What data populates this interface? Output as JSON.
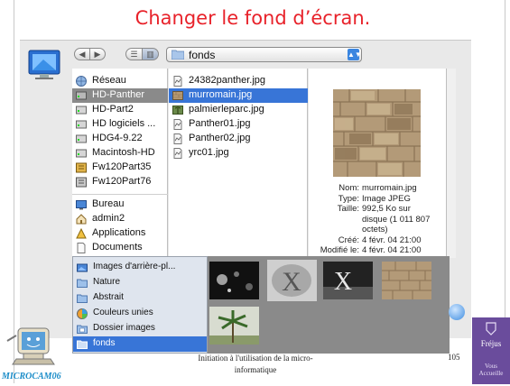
{
  "slide": {
    "title": "Changer le fond d’écran.",
    "footer": "Initiation à l'utilisation de la micro-informatique",
    "page_number": "105",
    "mascot_label": "MICROCAM06",
    "logo_text": "Fréjus",
    "logo_subtext": "Vous Accueille"
  },
  "toolbar": {
    "back_label": "◀",
    "forward_label": "▶",
    "list_view_label": "☰",
    "column_view_label": "▥",
    "path_title": "fonds"
  },
  "sidebar": [
    {
      "label": "Réseau",
      "icon": "globe-icon"
    },
    {
      "label": "HD-Panther",
      "icon": "hard-drive-icon",
      "selected": true
    },
    {
      "label": "HD-Part2",
      "icon": "hard-drive-icon"
    },
    {
      "label": "HD logiciels ...",
      "icon": "hard-drive-icon"
    },
    {
      "label": "HDG4-9.22",
      "icon": "hard-drive-icon"
    },
    {
      "label": "Macintosh-HD",
      "icon": "hard-drive-icon"
    },
    {
      "label": "Fw120Part35",
      "icon": "firewire-drive-icon"
    },
    {
      "label": "Fw120Part76",
      "icon": "firewire-drive-icon"
    },
    {
      "label": "Bureau",
      "icon": "desktop-icon"
    },
    {
      "label": "admin2",
      "icon": "home-icon"
    },
    {
      "label": "Applications",
      "icon": "applications-icon"
    },
    {
      "label": "Documents",
      "icon": "document-icon"
    }
  ],
  "files": [
    {
      "label": "24382panther.jpg"
    },
    {
      "label": "murromain.jpg",
      "selected": true
    },
    {
      "label": "palmierleparc.jpg"
    },
    {
      "label": "Panther01.jpg"
    },
    {
      "label": "Panther02.jpg"
    },
    {
      "label": "yrc01.jpg"
    }
  ],
  "info": {
    "nom_label": "Nom:",
    "nom": "murromain.jpg",
    "type_label": "Type:",
    "type": "Image JPEG",
    "taille_label": "Taille:",
    "taille_1": "992,5 Ko sur",
    "taille_2": "disque (1 011 807",
    "taille_3": "octets)",
    "cree_label": "Créé:",
    "cree": "4 févr. 04 21:00",
    "modifie_label": "Modifié le:",
    "modifie": "4 févr. 04 21:00"
  },
  "drawer": [
    {
      "label": "Images d'arrière-pl..."
    },
    {
      "label": "Nature"
    },
    {
      "label": "Abstrait"
    },
    {
      "label": "Couleurs unies"
    },
    {
      "label": "Dossier images"
    },
    {
      "label": "fonds",
      "selected": true
    }
  ],
  "colors": {
    "title": "#e8222a",
    "selection": "#3875d7",
    "selection_inactive": "#8a8a8a",
    "logo_bg": "#6a4c9c",
    "mascot_label": "#1a8cc8"
  }
}
